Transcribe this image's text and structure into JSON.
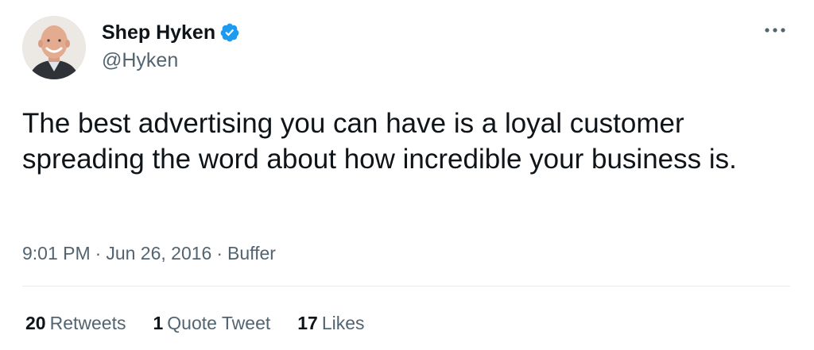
{
  "author": {
    "display_name": "Shep Hyken",
    "handle": "@Hyken",
    "verified": true,
    "verified_color": "#1d9bf0"
  },
  "tweet": {
    "text": "The best advertising you can have is a loyal customer spreading the word about how incredible your business is.",
    "time": "9:01 PM",
    "separator": "·",
    "date": "Jun 26, 2016",
    "source": "Buffer"
  },
  "stats": [
    {
      "count": "20",
      "label": "Retweets"
    },
    {
      "count": "1",
      "label": "Quote Tweet"
    },
    {
      "count": "17",
      "label": "Likes"
    }
  ],
  "icons": {
    "more": "more-options-icon",
    "verified": "verified-badge-icon"
  }
}
